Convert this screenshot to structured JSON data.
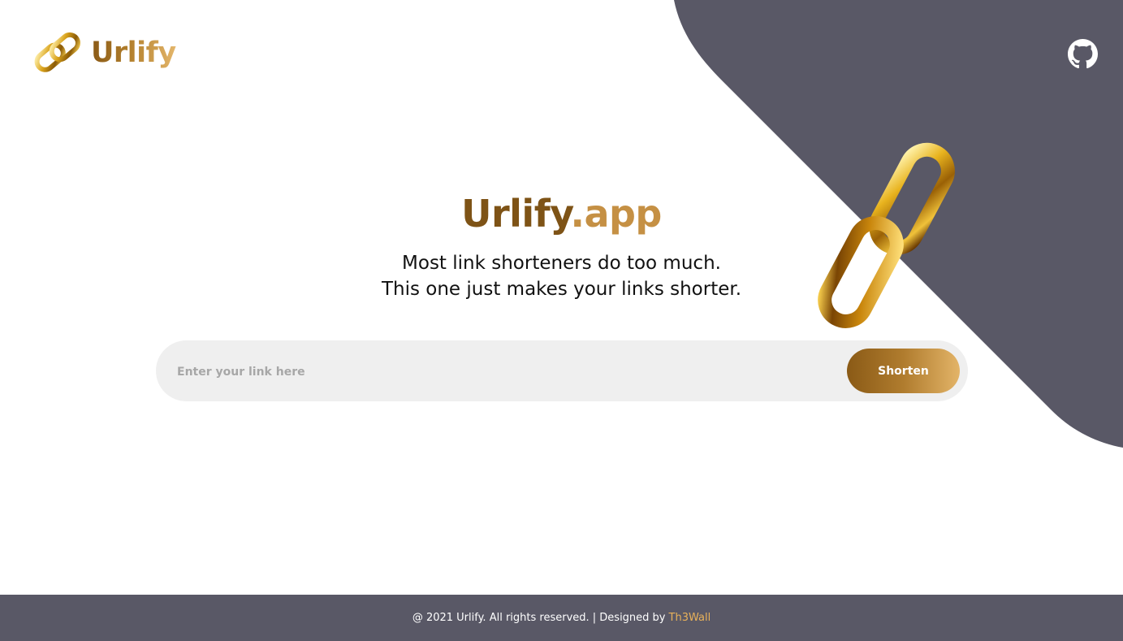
{
  "header": {
    "brand": "Urlify",
    "logo_icon": "chain-link-icon",
    "github_icon": "github-icon"
  },
  "hero": {
    "title_main": "Urlify",
    "title_suffix": ".app",
    "subtitle_line1": "Most link shorteners do too much.",
    "subtitle_line2": "This one just makes your links shorter.",
    "hero_icon": "chain-link-icon"
  },
  "form": {
    "input_placeholder": "Enter your link here",
    "input_value": "",
    "button_label": "Shorten"
  },
  "footer": {
    "text": "@ 2021 Urlify. All rights reserved. | Designed by",
    "designer_link": "Th3Wall"
  },
  "colors": {
    "accent_dark": "#7e5316",
    "accent_light": "#e3b468",
    "panel": "#595866",
    "input_bg": "#efefef"
  }
}
